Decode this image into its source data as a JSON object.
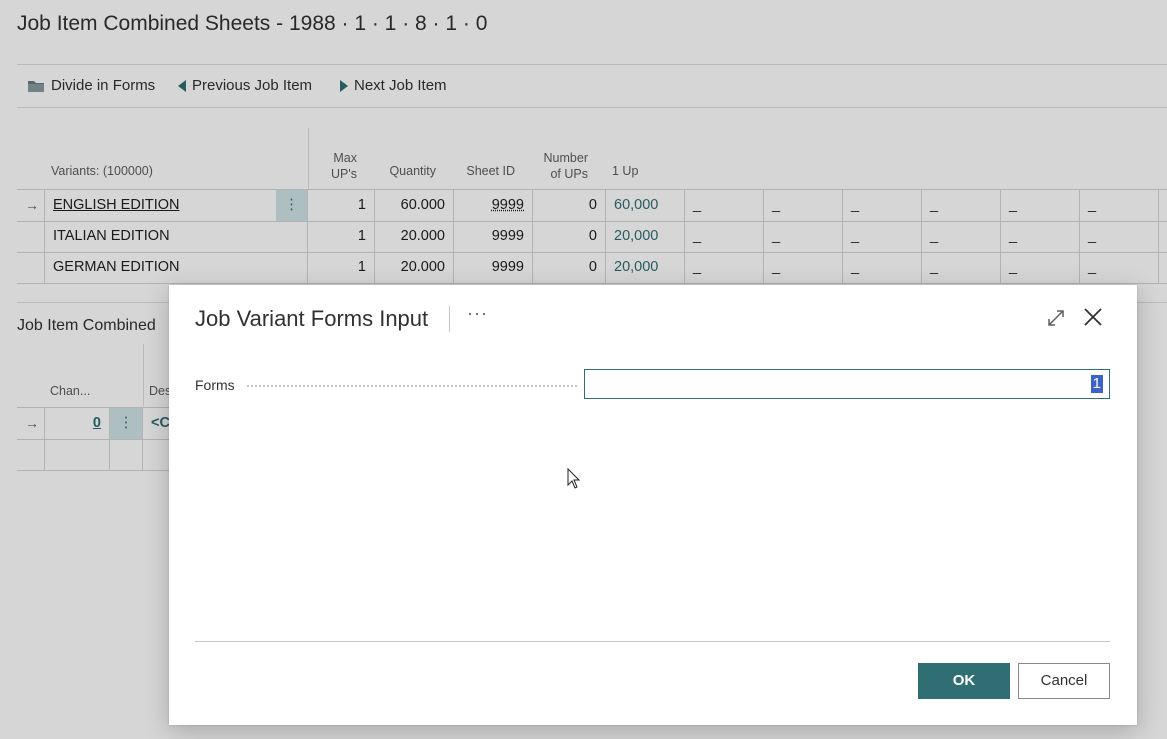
{
  "page": {
    "title": "Job Item Combined Sheets - 1988 · 1 · 1 · 8 · 1 · 0",
    "actions": [
      {
        "label": "Divide in Forms",
        "icon": "folder-icon"
      },
      {
        "label": "Previous Job Item",
        "icon": "triangle-left-icon"
      },
      {
        "label": "Next Job Item",
        "icon": "triangle-right-icon"
      }
    ]
  },
  "variants": {
    "headers": {
      "variants": "Variants: (100000)",
      "max_ups_1": "Max",
      "max_ups_2": "UP's",
      "quantity": "Quantity",
      "sheet_id": "Sheet ID",
      "number_of_ups_1": "Number",
      "number_of_ups_2": "of UPs",
      "one_up": "1 Up"
    },
    "rows": [
      {
        "name": "ENGLISH EDITION",
        "max_ups": "1",
        "quantity": "60.000",
        "sheet_id": "9999",
        "number_of_ups": "0",
        "one_up": "60,000",
        "dashes": [
          "_",
          "_",
          "_",
          "_",
          "_",
          "_"
        ]
      },
      {
        "name": "ITALIAN EDITION",
        "max_ups": "1",
        "quantity": "20.000",
        "sheet_id": "9999",
        "number_of_ups": "0",
        "one_up": "20,000",
        "dashes": [
          "_",
          "_",
          "_",
          "_",
          "_",
          "_"
        ]
      },
      {
        "name": "GERMAN EDITION",
        "max_ups": "1",
        "quantity": "20.000",
        "sheet_id": "9999",
        "number_of_ups": "0",
        "one_up": "20,000",
        "dashes": [
          "_",
          "_",
          "_",
          "_",
          "_",
          "_"
        ]
      }
    ]
  },
  "combined": {
    "title": "Job Item Combined",
    "headers": {
      "chan": "Chan...",
      "des": "Des"
    },
    "row": {
      "chan_value": "0",
      "des_value": "<C"
    }
  },
  "dialog": {
    "title": "Job Variant Forms Input",
    "more": "···",
    "field_label": "Forms",
    "field_value": "1",
    "ok_label": "OK",
    "cancel_label": "Cancel"
  },
  "colors": {
    "accent": "#2f6e73",
    "selection": "#3a62c8"
  }
}
